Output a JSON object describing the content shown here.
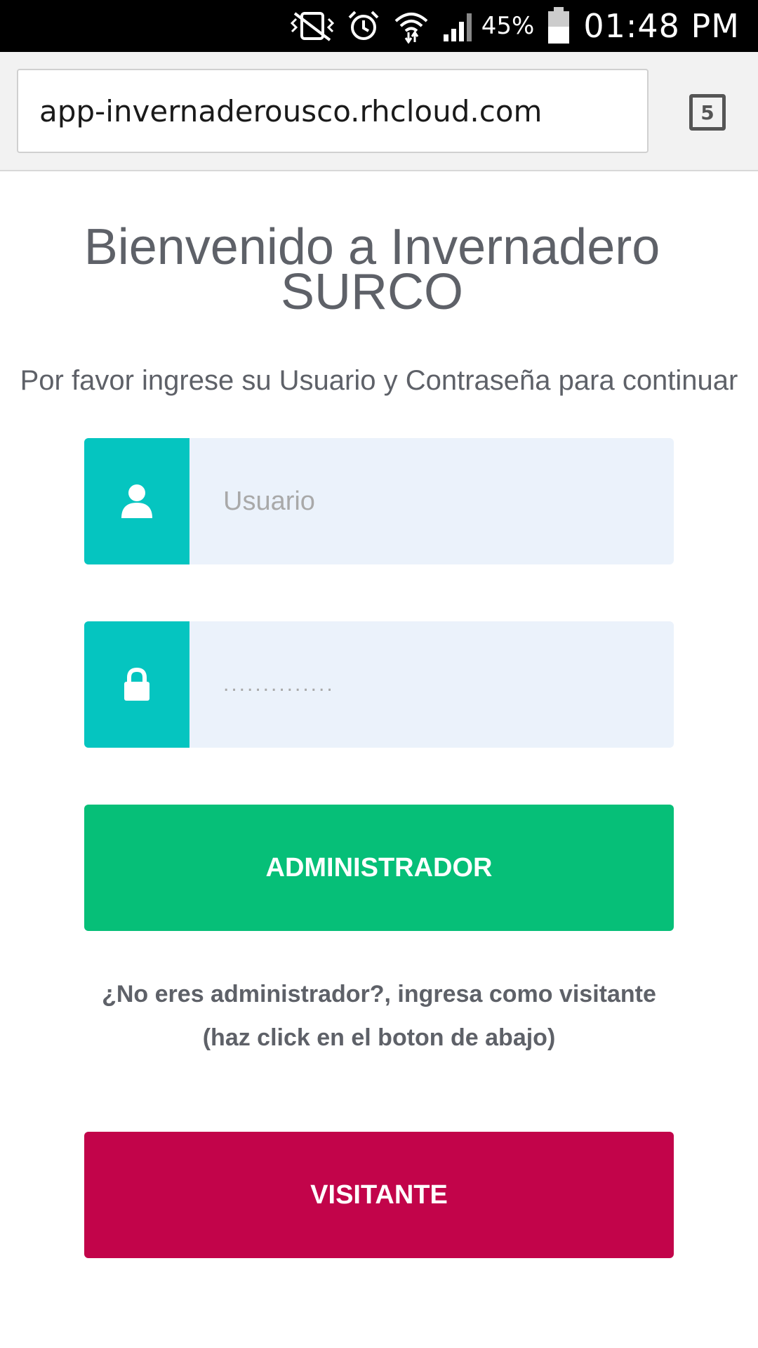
{
  "status_bar": {
    "battery_percent": "45%",
    "time": "01:48 PM",
    "icons": [
      "mute-vibrate-icon",
      "alarm-icon",
      "wifi-icon",
      "signal-icon",
      "battery-icon"
    ]
  },
  "browser": {
    "url": "app-invernaderousco.rhcloud.com",
    "tab_count": "5"
  },
  "page": {
    "title_line1": "Bienvenido a Invernadero",
    "title_line2": "SURCO",
    "subtitle": "Por favor ingrese su Usuario y Contraseña para continuar"
  },
  "form": {
    "username": {
      "placeholder": "Usuario",
      "icon": "user-icon"
    },
    "password": {
      "placeholder": "..............",
      "icon": "lock-icon"
    },
    "admin_button": "ADMINISTRADOR",
    "help_line1": "¿No eres administrador?, ingresa como visitante",
    "help_line2": "(haz click en el boton de abajo)",
    "visitor_button": "VISITANTE"
  },
  "colors": {
    "addon": "#05c5c0",
    "input_bg": "#ebf2fb",
    "admin_button": "#06bf78",
    "visitor_button": "#c2044a",
    "text": "#5e6168"
  }
}
